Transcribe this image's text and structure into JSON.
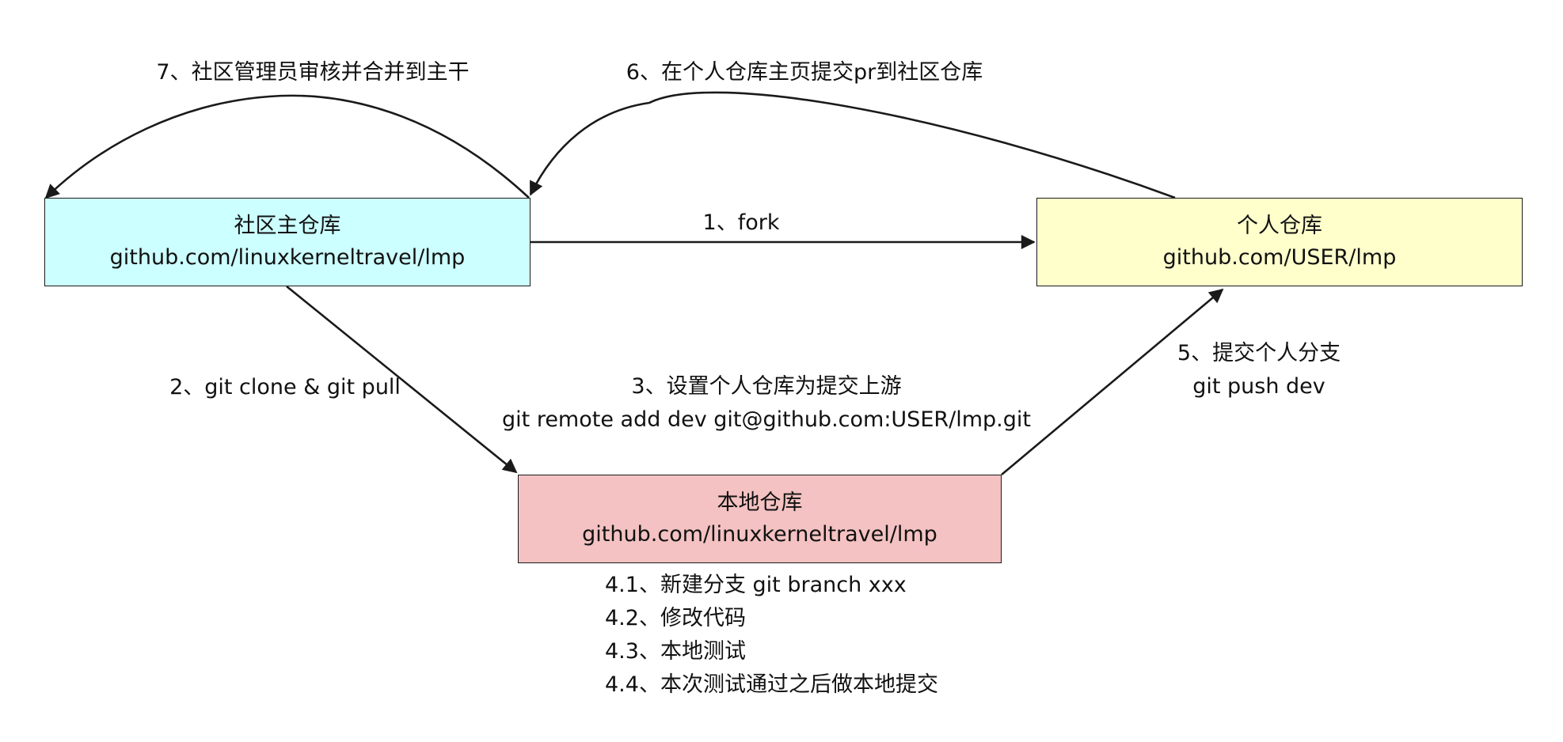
{
  "colors": {
    "community_fill": "#ccffff",
    "personal_fill": "#ffffcc",
    "local_fill": "#f4c2c2",
    "stroke": "#1a1a1a",
    "text": "#111111"
  },
  "nodes": {
    "community": {
      "title": "社区主仓库",
      "url": "github.com/linuxkerneltravel/lmp"
    },
    "personal": {
      "title": "个人仓库",
      "url": "github.com/USER/lmp"
    },
    "local": {
      "title": "本地仓库",
      "url": "github.com/linuxkerneltravel/lmp"
    }
  },
  "edges": {
    "step1": {
      "label": "1、fork"
    },
    "step2": {
      "label": "2、git clone & git pull"
    },
    "step3": {
      "title": "3、设置个人仓库为提交上游",
      "command": "git remote add dev git@github.com:USER/lmp.git"
    },
    "step4": {
      "items": [
        "4.1、新建分支 git branch xxx",
        "4.2、修改代码",
        "4.3、本地测试",
        "4.4、本次测试通过之后做本地提交"
      ]
    },
    "step5": {
      "title": "5、提交个人分支",
      "command": "git push dev"
    },
    "step6": {
      "label": "6、在个人仓库主页提交pr到社区仓库"
    },
    "step7": {
      "label": "7、社区管理员审核并合并到主干"
    }
  }
}
